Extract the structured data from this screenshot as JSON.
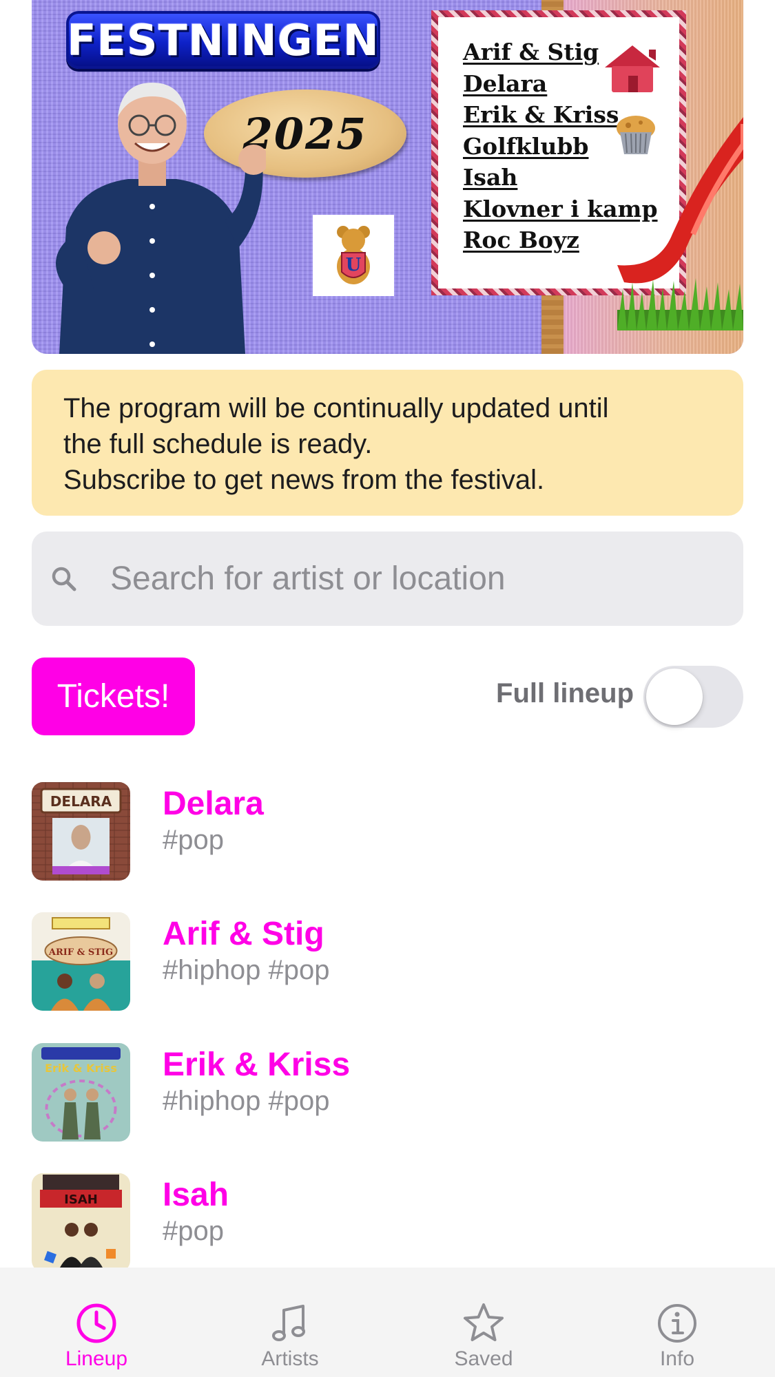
{
  "banner": {
    "logo_text": "FESTNINGEN",
    "year_text": "2025",
    "lineup": [
      "Arif & Stig",
      "Delara",
      "Erik & Kriss",
      "Golfklubb",
      "Isah",
      "Klovner i kamp",
      "Roc Boyz"
    ]
  },
  "notice": {
    "line1": "The program will be continually updated until",
    "line2": "the full schedule is ready.",
    "line3": "Subscribe to get news from the festival."
  },
  "search": {
    "placeholder": "Search for artist or location",
    "value": ""
  },
  "controls": {
    "tickets_label": "Tickets!",
    "full_lineup_label": "Full lineup",
    "full_lineup_on": false
  },
  "artists": [
    {
      "name": "Delara",
      "tags": "#pop",
      "thumb_text": "DELARA"
    },
    {
      "name": "Arif & Stig",
      "tags": "#hiphop #pop",
      "thumb_text": "ARIF & STIG"
    },
    {
      "name": "Erik & Kriss",
      "tags": "#hiphop #pop",
      "thumb_text": "Erik & Kriss"
    },
    {
      "name": "Isah",
      "tags": "#pop",
      "thumb_text": "ISAH"
    }
  ],
  "tabbar": {
    "tabs": [
      {
        "label": "Lineup",
        "icon": "clock-icon",
        "active": true
      },
      {
        "label": "Artists",
        "icon": "music-note-icon",
        "active": false
      },
      {
        "label": "Saved",
        "icon": "star-icon",
        "active": false
      },
      {
        "label": "Info",
        "icon": "info-icon",
        "active": false
      }
    ]
  },
  "colors": {
    "accent": "#ff00e6",
    "notice_bg": "#fde8b0",
    "search_bg": "#ebebee",
    "tab_inactive": "#8e8e93"
  }
}
